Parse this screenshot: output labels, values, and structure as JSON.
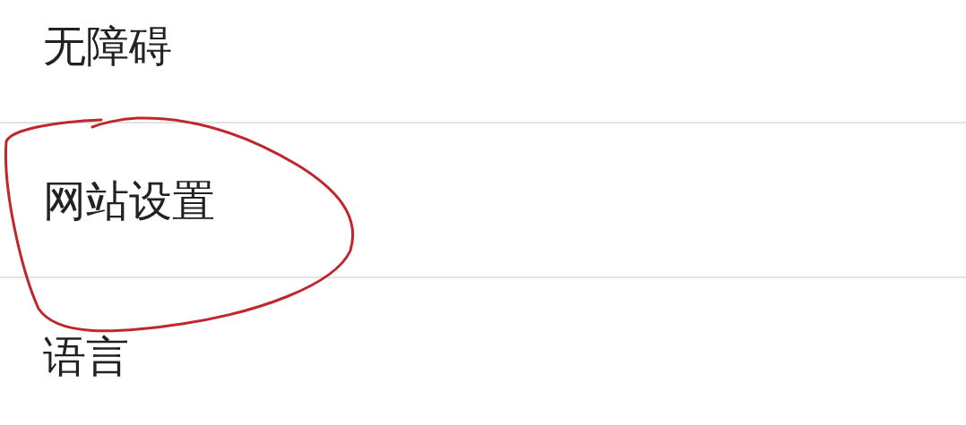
{
  "settings_list": {
    "items": [
      {
        "label": "无障碍",
        "circled": false
      },
      {
        "label": "网站设置",
        "circled": true
      },
      {
        "label": "语言",
        "circled": false
      }
    ]
  }
}
